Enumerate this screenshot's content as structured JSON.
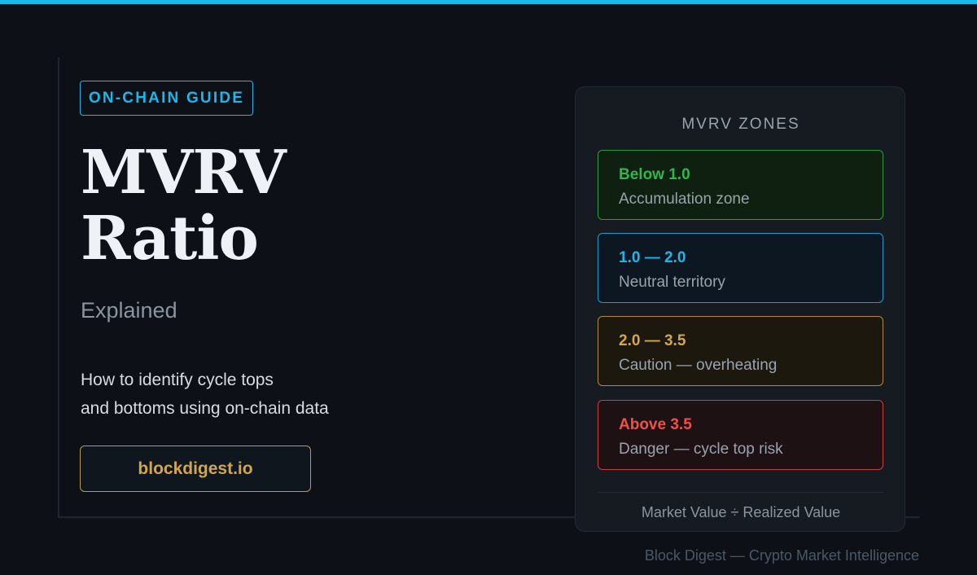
{
  "theme": {
    "accent": "#1ab8ea",
    "gold": "#d4a64a",
    "background": "#0d1117"
  },
  "hero": {
    "badge": "ON-CHAIN GUIDE",
    "title_line1": "MVRV",
    "title_line2": "Ratio",
    "subtitle": "Explained",
    "description_line1": "How to identify cycle tops",
    "description_line2": "and bottoms using on-chain data",
    "site_button": "blockdigest.io"
  },
  "zones_card": {
    "title": "MVRV ZONES",
    "zones": [
      {
        "range": "Below 1.0",
        "label": "Accumulation zone",
        "color": "#2eb84a",
        "border": "#2b9a40",
        "bg": "#0f2010"
      },
      {
        "range": "1.0 — 2.0",
        "label": "Neutral territory",
        "color": "#1ab8ea",
        "border": "#1a9ccc",
        "bg": "#0d1721"
      },
      {
        "range": "2.0 — 3.5",
        "label": "Caution — overheating",
        "color": "#d4a64a",
        "border": "#b08a38",
        "bg": "#1d180e"
      },
      {
        "range": "Above 3.5",
        "label": "Danger — cycle top risk",
        "color": "#f0504a",
        "border": "#c8403c",
        "bg": "#1e1113"
      }
    ],
    "formula": "Market Value ÷ Realized Value"
  },
  "footer": "Block Digest — Crypto Market Intelligence"
}
